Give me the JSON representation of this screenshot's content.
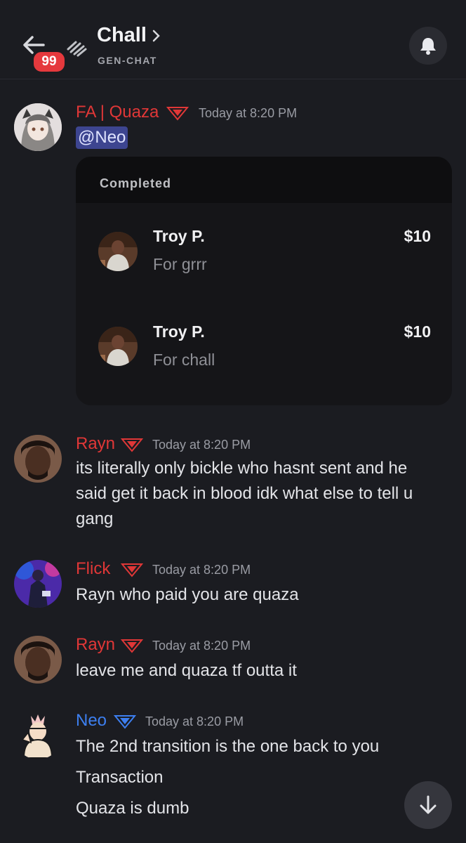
{
  "header": {
    "back_icon": "arrow-left-icon",
    "badge_count": "99",
    "channel_icon": "thread-icon",
    "title": "Chall",
    "subtitle": "GEN-CHAT",
    "bell_icon": "bell-icon"
  },
  "colors": {
    "background": "#1b1c21",
    "accent_red": "#e03737",
    "accent_blue": "#3d7ff0",
    "mention_bg": "#3d4590",
    "badge": "#e5393d"
  },
  "messages": [
    {
      "author": "FA | Quaza",
      "time": "Today at 8:20 PM",
      "mention": "@Neo",
      "embed": {
        "status": "Completed",
        "rows": [
          {
            "name": "Troy P.",
            "note": "For grrr",
            "amount": "$10"
          },
          {
            "name": "Troy P.",
            "note": "For chall",
            "amount": "$10"
          }
        ]
      }
    },
    {
      "author": "Rayn",
      "time": "Today at 8:20 PM",
      "lines": [
        "its literally only bickle who hasnt sent and he",
        "said get it back in blood idk what else to tell u",
        "gang"
      ]
    },
    {
      "author": "Flick",
      "time": "Today at 8:20 PM",
      "lines": [
        "Rayn who paid you are quaza"
      ]
    },
    {
      "author": "Rayn",
      "time": "Today at 8:20 PM",
      "lines": [
        "leave me and quaza tf outta it"
      ]
    },
    {
      "author": "Neo",
      "time": "Today at 8:20 PM",
      "lines": [
        "The 2nd transition is the one back to you",
        "Transaction",
        "Quaza is dumb"
      ]
    }
  ],
  "scroll_down_icon": "arrow-down-icon"
}
